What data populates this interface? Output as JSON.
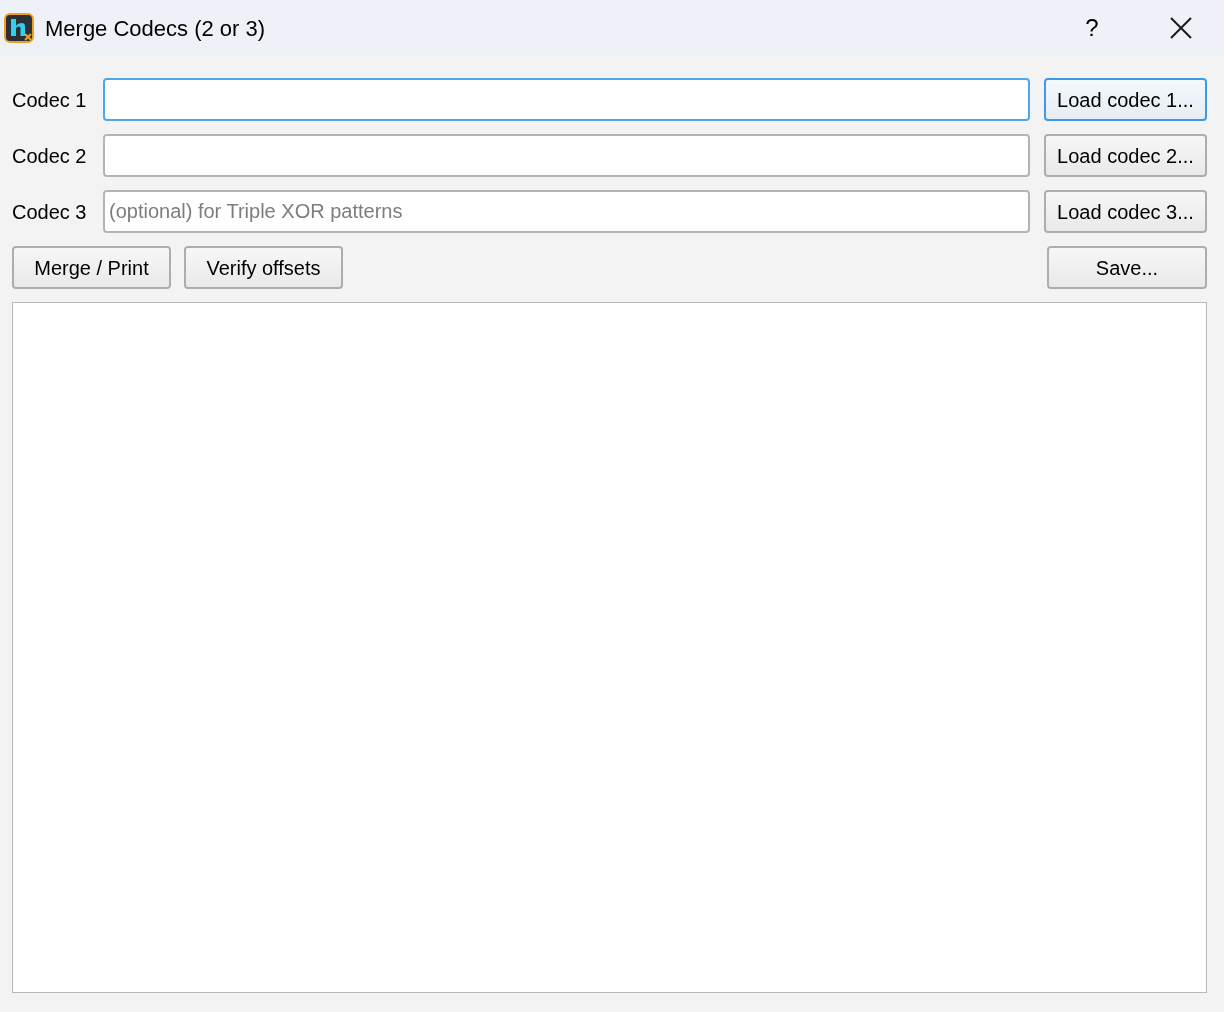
{
  "window": {
    "title": "Merge Codecs (2 or 3)",
    "help": "?"
  },
  "codec_rows": [
    {
      "label": "Codec 1",
      "focused": true,
      "button": {
        "label": "Load codec 1...",
        "default": true
      }
    },
    {
      "label": "Codec 2",
      "focused": false,
      "button": {
        "label": "Load codec 2...",
        "default": false
      }
    },
    {
      "label": "Codec 3",
      "focused": false,
      "placeholder": "(optional) for Triple XOR patterns",
      "button": {
        "label": "Load codec 3...",
        "default": false
      }
    }
  ],
  "actions": [
    {
      "label": "Merge / Print"
    },
    {
      "label": "Verify offsets"
    }
  ],
  "save_button": {
    "label": "Save..."
  }
}
